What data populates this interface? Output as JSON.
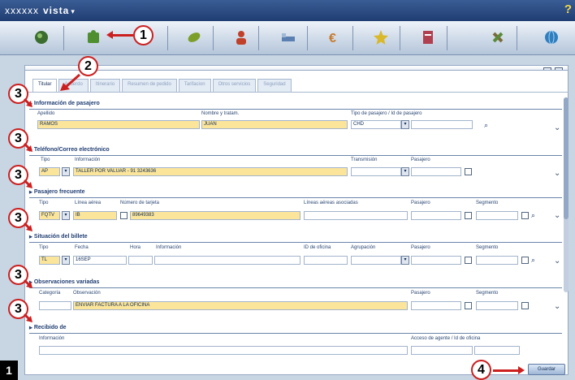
{
  "app": {
    "brand_part1": "xxxxxx",
    "brand_part2": "vista",
    "brand_chevron": "▾",
    "help": "?"
  },
  "toolbar": {
    "modules": [
      {
        "icon": "globe-icon",
        "color": "#3b6e2e"
      },
      {
        "icon": "puzzle-icon",
        "color": "#4f8f2f"
      },
      {
        "icon": "leaf-icon",
        "color": "#7c9f2a"
      },
      {
        "icon": "person-icon",
        "color": "#c0402a"
      },
      {
        "icon": "bed-icon",
        "color": "#5a7fb0"
      },
      {
        "icon": "currency-icon",
        "color": "#c87a2a"
      },
      {
        "icon": "star-icon",
        "color": "#d9b82a"
      },
      {
        "icon": "document-icon",
        "color": "#b04050"
      },
      {
        "icon": "tools-icon",
        "color": "#7a6a3a"
      },
      {
        "icon": "world-icon",
        "color": "#2f7fc0"
      }
    ]
  },
  "tabs": [
    "Titular",
    "Acuerdo",
    "Itinerario",
    "Resumen de pedido",
    "Tarifacion",
    "Otros servicios",
    "Seguridad"
  ],
  "sections": {
    "pax": {
      "title": "Información de pasajero",
      "labels": {
        "surname": "Apellido",
        "name": "Nombre y tratam.",
        "type": "Tipo de pasajero / Id de pasajero"
      },
      "values": {
        "surname": "RAMOS",
        "name": "JUAN",
        "type": "CHD"
      }
    },
    "contact": {
      "title": "Teléfono/Correo electrónico",
      "labels": {
        "type": "Tipo",
        "info": "Información",
        "transmission": "Transmisión",
        "passenger": "Pasajero"
      },
      "values": {
        "type": "AP",
        "info": "TALLER POR VALUAR - 91 3243636"
      }
    },
    "frequent": {
      "title": "Pasajero frecuente",
      "labels": {
        "type": "Tipo",
        "airline": "Línea aérea",
        "card": "Número de tarjeta",
        "partner": "Líneas aéreas asociadas",
        "passenger": "Pasajero",
        "segment": "Segmento"
      },
      "values": {
        "type": "FQTV",
        "airline": "IB",
        "card": "89649383"
      }
    },
    "ticket": {
      "title": "Situación del billete",
      "labels": {
        "type": "Tipo",
        "date": "Fecha",
        "time": "Hora",
        "info": "Información",
        "office": "ID de oficina",
        "queue": "Agrupación",
        "passenger": "Pasajero",
        "segment": "Segmento"
      },
      "values": {
        "type": "TL",
        "date": "16SEP"
      }
    },
    "remarks": {
      "title": "Observaciones variadas",
      "labels": {
        "category": "Categoría",
        "remark": "Observación",
        "passenger": "Pasajero",
        "segment": "Segmento"
      },
      "values": {
        "remark": "ENVIAR FACTURA A LA OFICINA"
      }
    },
    "receive": {
      "title": "Recibido de",
      "labels": {
        "info": "Información",
        "agent": "Acceso de agente / Id de oficina"
      }
    }
  },
  "buttons": {
    "save": "Guardar"
  },
  "annotations": {
    "c1": "1",
    "c2": "2",
    "c3": "3",
    "c4": "4",
    "figure": "1"
  }
}
